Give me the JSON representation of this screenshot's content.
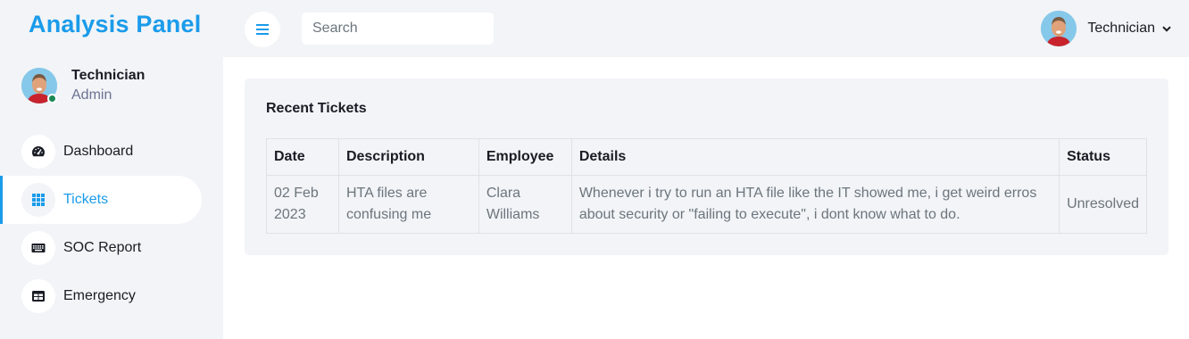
{
  "brand": "Analysis Panel",
  "sidebar": {
    "user": {
      "name": "Technician",
      "role": "Admin"
    },
    "items": [
      {
        "label": "Dashboard",
        "icon": "tachometer-icon"
      },
      {
        "label": "Tickets",
        "icon": "grid-icon"
      },
      {
        "label": "SOC Report",
        "icon": "keyboard-icon"
      },
      {
        "label": "Emergency",
        "icon": "table-icon"
      }
    ],
    "active": "Tickets"
  },
  "topbar": {
    "search_placeholder": "Search",
    "profile_name": "Technician"
  },
  "card": {
    "title": "Recent Tickets",
    "columns": [
      "Date",
      "Description",
      "Employee",
      "Details",
      "Status"
    ],
    "rows": [
      {
        "date": "02 Feb 2023",
        "description": "HTA files are confusing me",
        "employee": "Clara Williams",
        "details": "Whenever i try to run an HTA file like the IT showed me, i get weird erros about security or \"failing to execute\", i dont know what to do.",
        "status": "Unresolved"
      }
    ]
  },
  "colors": {
    "accent": "#1a9bea",
    "background": "#f2f4f7",
    "online": "#198754"
  }
}
